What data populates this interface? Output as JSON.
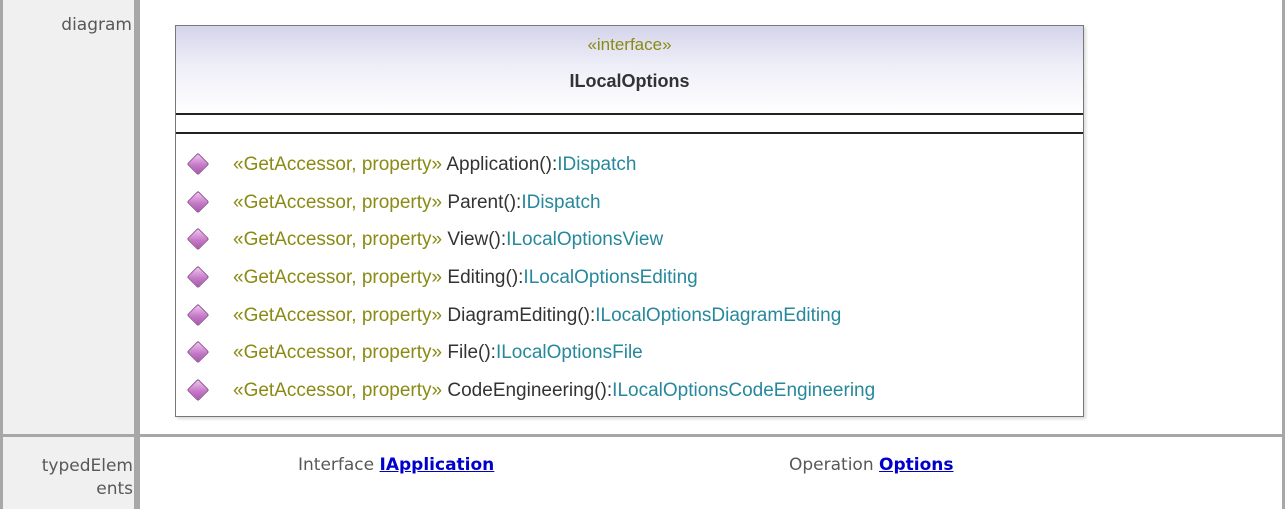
{
  "rows": {
    "diagram_label": "diagram",
    "typed_label": "typedElem ents"
  },
  "uml": {
    "stereotype": "«interface»",
    "class_name": "ILocalOptions",
    "operations": [
      {
        "stereotype": "«GetAccessor, property»",
        "name": "Application()",
        "sep": ":",
        "type": "IDispatch"
      },
      {
        "stereotype": "«GetAccessor, property»",
        "name": "Parent()",
        "sep": ":",
        "type": "IDispatch"
      },
      {
        "stereotype": "«GetAccessor, property»",
        "name": "View()",
        "sep": ":",
        "type": "ILocalOptionsView"
      },
      {
        "stereotype": "«GetAccessor, property»",
        "name": "Editing()",
        "sep": ":",
        "type": "ILocalOptionsEditing"
      },
      {
        "stereotype": "«GetAccessor, property»",
        "name": "DiagramEditing()",
        "sep": ":",
        "type": "ILocalOptionsDiagramEditing"
      },
      {
        "stereotype": "«GetAccessor, property»",
        "name": "File()",
        "sep": ":",
        "type": "ILocalOptionsFile"
      },
      {
        "stereotype": "«GetAccessor, property»",
        "name": "CodeEngineering()",
        "sep": ":",
        "type": "ILocalOptionsCodeEngineering"
      }
    ],
    "operation_icon": "public-operation-icon"
  },
  "typed_elements": [
    {
      "kind": "Interface",
      "link": "IApplication"
    },
    {
      "kind": "Operation",
      "link": "Options"
    }
  ],
  "colors": {
    "border": "#a7a7a7",
    "label_bg": "#f0f0f0",
    "stereotype": "#8a8a14",
    "type": "#27889c",
    "link": "#0000cc"
  }
}
